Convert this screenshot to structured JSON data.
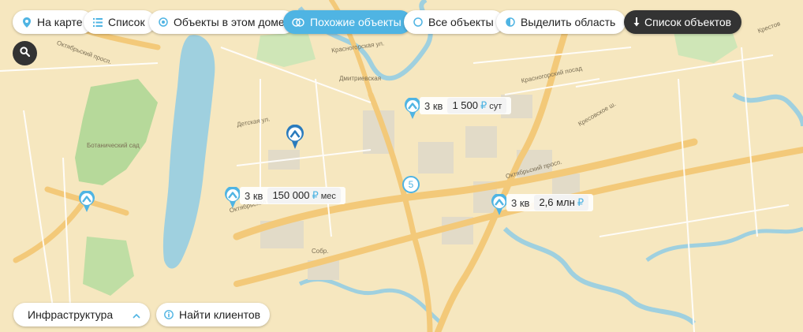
{
  "toolbar": {
    "on_map": "На карте",
    "list": "Список",
    "objects_in_house": "Объекты в этом доме",
    "similar_objects": "Похожие объекты",
    "all_objects": "Все объекты",
    "select_area": "Выделить область",
    "objects_list": "Список объектов"
  },
  "listings": [
    {
      "rooms": "3 кв",
      "price": "1 500",
      "currency": "₽",
      "period": "сут"
    },
    {
      "rooms": "3 кв",
      "price": "150 000",
      "currency": "₽",
      "period": "мес"
    },
    {
      "rooms": "3 кв",
      "price": "2,6 млн",
      "currency": "₽",
      "period": ""
    }
  ],
  "cluster": {
    "count": "5"
  },
  "bottom": {
    "infrastructure": "Инфраструктура",
    "find_clients": "Найти клиентов"
  },
  "map_labels": {
    "road_1": "Октябрьский просп.",
    "road_2": "Ботанический сад",
    "road_3": "Красногорская ул.",
    "road_4": "Дмитриевская",
    "road_5": "Красногорский посад",
    "road_6": "Кресовское ш.",
    "road_7": "Октябрьский просп.",
    "road_8": "Октябрьская ул.",
    "road_9": "Крестов",
    "road_10": "Детская ул.",
    "road_11": "Собр."
  },
  "colors": {
    "accent": "#4fb4e3",
    "dark": "#333333",
    "water": "#9fd0df",
    "park": "#b6d99a",
    "land": "#f6e7bf",
    "major_road": "#f3c979"
  }
}
